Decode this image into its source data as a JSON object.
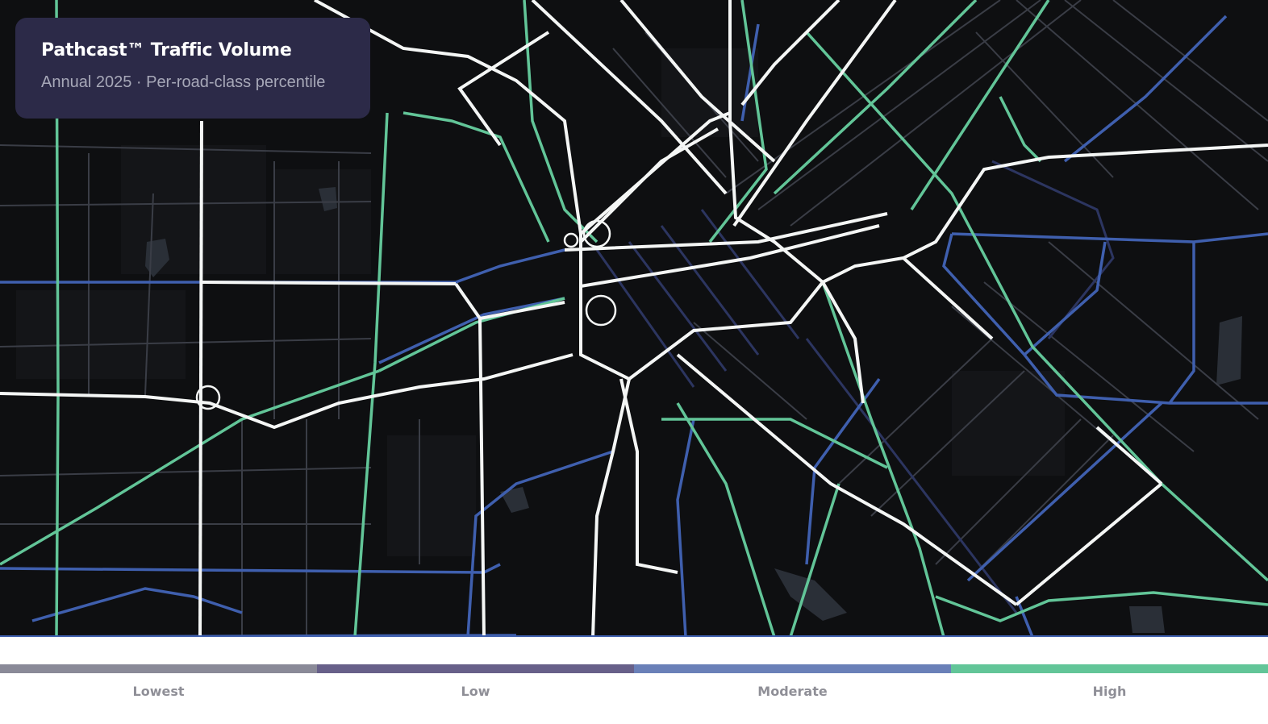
{
  "title_card": {
    "title": "Pathcast™ Traffic Volume",
    "subtitle": "Annual 2025 · Per-road-class percentile"
  },
  "legend": [
    {
      "label": "Lowest",
      "color": "#8a8a98"
    },
    {
      "label": "Low",
      "color": "#676089"
    },
    {
      "label": "Moderate",
      "color": "#6a80b8"
    },
    {
      "label": "High",
      "color": "#62c598"
    }
  ],
  "map_style": {
    "background": "#0e0f11",
    "road_colors": {
      "highest": "#ffffff",
      "high": "#62c598",
      "moderate": "#3f5fae",
      "low": "#2c3560",
      "lowest": "#3a3d46"
    }
  }
}
